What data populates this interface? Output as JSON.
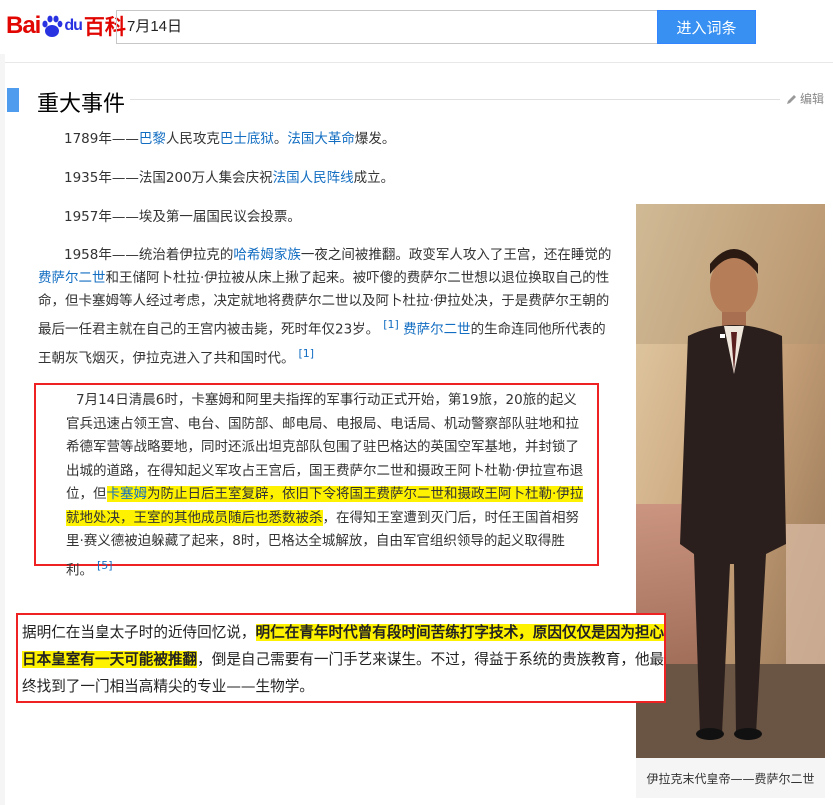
{
  "header": {
    "logo_text_1": "Bai",
    "logo_text_2": "du",
    "logo_text_3": "百科",
    "search_value": "7月14日",
    "search_button": "进入词条"
  },
  "section": {
    "title": "重大事件",
    "edit_label": "编辑"
  },
  "events": {
    "e1789": {
      "pre": "1789年——",
      "l1": "巴黎",
      "mid1": "人民攻克",
      "l2": "巴士底狱",
      "mid2": "。",
      "l3": "法国大革命",
      "post": "爆发。"
    },
    "e1935": {
      "pre": "1935年——法国200万人集会庆祝",
      "l1": "法国人民阵线",
      "post": "成立。"
    },
    "e1957": {
      "text": "1957年——埃及第一届国民议会投票。"
    },
    "e1958": {
      "t1": "1958年——统治着伊拉克的",
      "l1": "哈希姆家族",
      "t2": "一夜之间被推翻。政变军人攻入了王宫，还在睡觉的",
      "l2": "费萨尔二世",
      "t3": "和王储阿卜杜拉·伊拉被从床上揪了起来。被吓傻的费萨尔二世想以退位换取自己的性命，但卡塞姆等人经过考虑，决定就地将费萨尔二世以及阿卜杜拉·伊拉处决，于是费萨尔王朝的最后一任君主就在自己的王宫内被击毙，死时年仅23岁。",
      "ref1": "[1]",
      "l3": "费萨尔二世",
      "t4": "的生命连同他所代表的王朝灰飞烟灭，伊拉克进入了共和国时代。",
      "ref2": "[1]"
    }
  },
  "box1": {
    "t1": "7月14日清晨6时，卡塞姆和阿里夫指挥的军事行动正式开始，第19旅，20旅的起义官兵迅速占领王宫、电台、国防部、邮电局、电报局、电话局、机动警察部队驻地和拉希德军营等战略要地，同时还派出坦克部队包围了驻巴格达的英国空军基地，并封锁了出城的道路，在得知起义军攻占王宫后，国王费萨尔二世和摄政王阿卜杜勒·伊拉宣布退位，但",
    "hl_link": "卡塞姆",
    "hl_text": "为防止日后王室复辟，依旧下令将国王费萨尔二世和摄政王阿卜杜勒·伊拉就地处决，王室的其他成员随后也悉数被杀",
    "t2": "，在得知王室遭到灭门后，时任王国首相努里·赛义德被迫躲藏了起来，8时，巴格达全城解放，自由军官组织领导的起义取得胜利。",
    "ref": "[5]"
  },
  "box2": {
    "t1": "据明仁在当皇太子时的近侍回忆说，",
    "hl": "明仁在青年时代曾有段时间苦练打字技术，原因仅仅是因为担心日本皇室有一天可能被推翻",
    "t2": "，倒是自己需要有一门手艺来谋生。不过，得益于系统的贵族教育，他最终找到了一门相当高精尖的专业——生物学。"
  },
  "photo": {
    "caption": "伊拉克末代皇帝——费萨尔二世"
  },
  "colors": {
    "brand_red": "#e10601",
    "link_blue": "#136ec2",
    "button_blue": "#3891f2",
    "highlight_yellow": "#fff200",
    "box_border_red": "#e22"
  }
}
